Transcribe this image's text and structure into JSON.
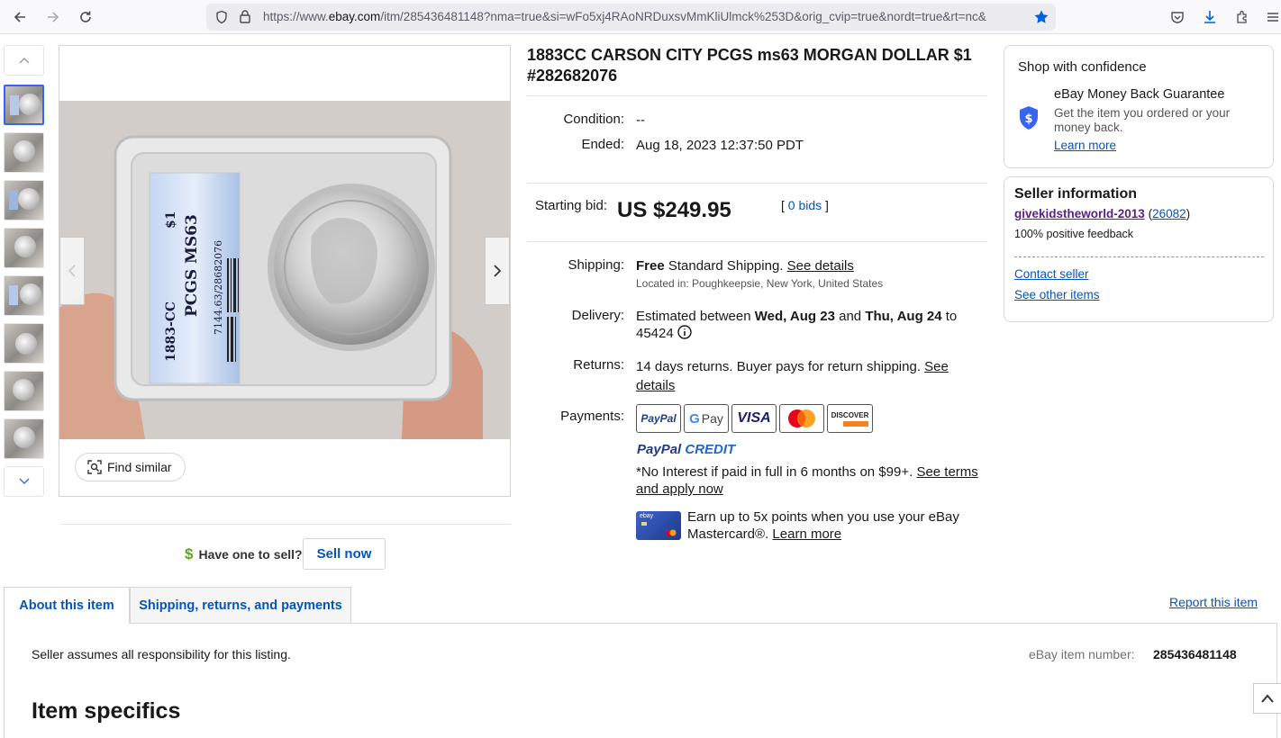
{
  "browser": {
    "url_prefix": "https://www.",
    "url_domain": "ebay.com",
    "url_rest": "/itm/285436481148?nma=true&si=wFo5xj4RAoNRDuxsvMmKliUlmck%253D&orig_cvip=true&nordt=true&rt=nc&"
  },
  "image": {
    "slab_grade": "PCGS MS63",
    "slab_year": "1883-CC",
    "slab_denom": "$1",
    "slab_cert": "7144.63/28682076",
    "find_similar": "Find similar"
  },
  "listing": {
    "title": "1883CC CARSON CITY PCGS ms63 MORGAN DOLLAR $1 #282682076",
    "condition_label": "Condition:",
    "condition_value": "--",
    "ended_label": "Ended:",
    "ended_value": "Aug 18, 2023 12:37:50 PDT",
    "bid_label": "Starting bid:",
    "bid_value": "US $249.95",
    "bids_open": "[",
    "bids_link": "0 bids",
    "bids_close": "]",
    "shipping_label": "Shipping:",
    "shipping_free": "Free",
    "shipping_text": "Standard Shipping.",
    "shipping_see": "See details",
    "located": "Located in: Poughkeepsie, New York, United States",
    "delivery_label": "Delivery:",
    "delivery_pre": "Estimated between",
    "delivery_from": "Wed, Aug 23",
    "delivery_and": "and",
    "delivery_to": "Thu, Aug 24",
    "delivery_post": "to",
    "delivery_zip": "45424",
    "returns_label": "Returns:",
    "returns_text": "14 days returns. Buyer pays for return shipping.",
    "returns_see": "See",
    "returns_details": "details",
    "payments_label": "Payments:",
    "pay_paypal": "PayPal",
    "pay_gpay_g": "G",
    "pay_gpay": "Pay",
    "pay_visa": "VISA",
    "pay_discover": "DISCOVER",
    "paypal_credit_a": "PayPal",
    "paypal_credit_b": "CREDIT",
    "no_interest": "*No Interest if paid in full in 6 months on $99+.",
    "see_terms": "See terms",
    "and_apply": "and apply now",
    "card_brand": "ebay",
    "earn_line1": "Earn up to 5x points when you use your eBay",
    "earn_line2": "Mastercard®.",
    "learn_more": "Learn more"
  },
  "confidence": {
    "heading": "Shop with confidence",
    "guarantee_title": "eBay Money Back Guarantee",
    "guarantee_text1": "Get the item you ordered or your",
    "guarantee_text2": "money back.",
    "learn_more": "Learn more"
  },
  "seller": {
    "heading": "Seller information",
    "name": "givekidstheworld-2013",
    "score_open": "(",
    "score": "26082",
    "score_close": ")",
    "feedback": "100% positive feedback",
    "contact": "Contact seller",
    "other_items": "See other items"
  },
  "sell": {
    "prompt": "Have one to sell?",
    "button": "Sell now"
  },
  "tabs": {
    "about": "About this item",
    "shipping": "Shipping, returns, and payments",
    "report": "Report this item"
  },
  "about": {
    "responsibility": "Seller assumes all responsibility for this listing.",
    "item_number_label": "eBay item number:",
    "item_number": "285436481148",
    "specifics_heading": "Item specifics"
  },
  "colors": {
    "link": "#0654ba",
    "accent": "#3665f3",
    "seller_link": "#5a1d8c"
  }
}
